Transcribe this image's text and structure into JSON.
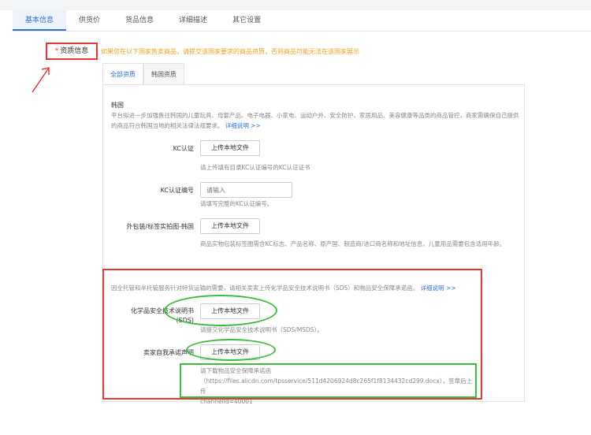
{
  "tabs": [
    {
      "label": "基本信息"
    },
    {
      "label": "供货价"
    },
    {
      "label": "货品信息"
    },
    {
      "label": "详细描述"
    },
    {
      "label": "其它设置"
    }
  ],
  "qualification": {
    "required_mark": "*",
    "label": "资质信息",
    "warning": "如果您在以下国家售卖商品，请提交该国家要求的商品资质，否则商品可能无法在该国家展示"
  },
  "subtabs": [
    {
      "label": "全部资质"
    },
    {
      "label": "韩国资质"
    }
  ],
  "korea": {
    "region": "韩国",
    "description": "平台拟进一步加强售往韩国的儿童玩具、母婴产品、电子电器、小家电、运动户外、安全防护、家居用品、美容健康等品类的商品管控，商家需确保自己提供的商品符合韩国当地的相关法律法规要求。",
    "detail_link": "详细说明 >>"
  },
  "fields": {
    "kc_cert": {
      "label": "KC认证",
      "button": "上传本地文件",
      "hint": "请上传填有目录KC认证编号的KC认证证书"
    },
    "kc_number": {
      "label": "KC认证编号",
      "placeholder": "请输入",
      "hint": "请填写完整的KC认证编号。"
    },
    "packaging": {
      "label": "外包装/标签实拍图-韩国",
      "button": "上传本地文件",
      "hint": "商品实物包装标签图需含KC标志、产品名称、原产国、制造商/进口商名称和地址信息，儿童用品需要包含适用年龄。"
    }
  },
  "sds_section": {
    "intro": "因全托管和半托管服务针对特货运输的需要，请相关卖家上传化学品安全技术说明书（SDS）和物品安全保障承诺函。",
    "detail_link": "详细说明 >>",
    "sds": {
      "label": "化学品安全技术说明书",
      "label_suffix": "(SDS)",
      "button": "上传本地文件",
      "hint": "请提交化学品安全技术说明书（SDS/MSDS）。"
    },
    "self_commitment": {
      "label": "卖家自我承诺声明",
      "button": "上传本地文件",
      "hint_line1": "请下载物品安全保障承诺函",
      "hint_line2": "（https://files.alicdn.com/tpsservice/511d4206924d8c265f1f8134432cd299.docx），签章后上传",
      "hint_line3": "channelId=40001"
    }
  },
  "colors": {
    "accent": "#2f6fe0",
    "warning": "#f0a020",
    "annotation_red": "#e53935",
    "annotation_green": "#3bbf3b"
  }
}
